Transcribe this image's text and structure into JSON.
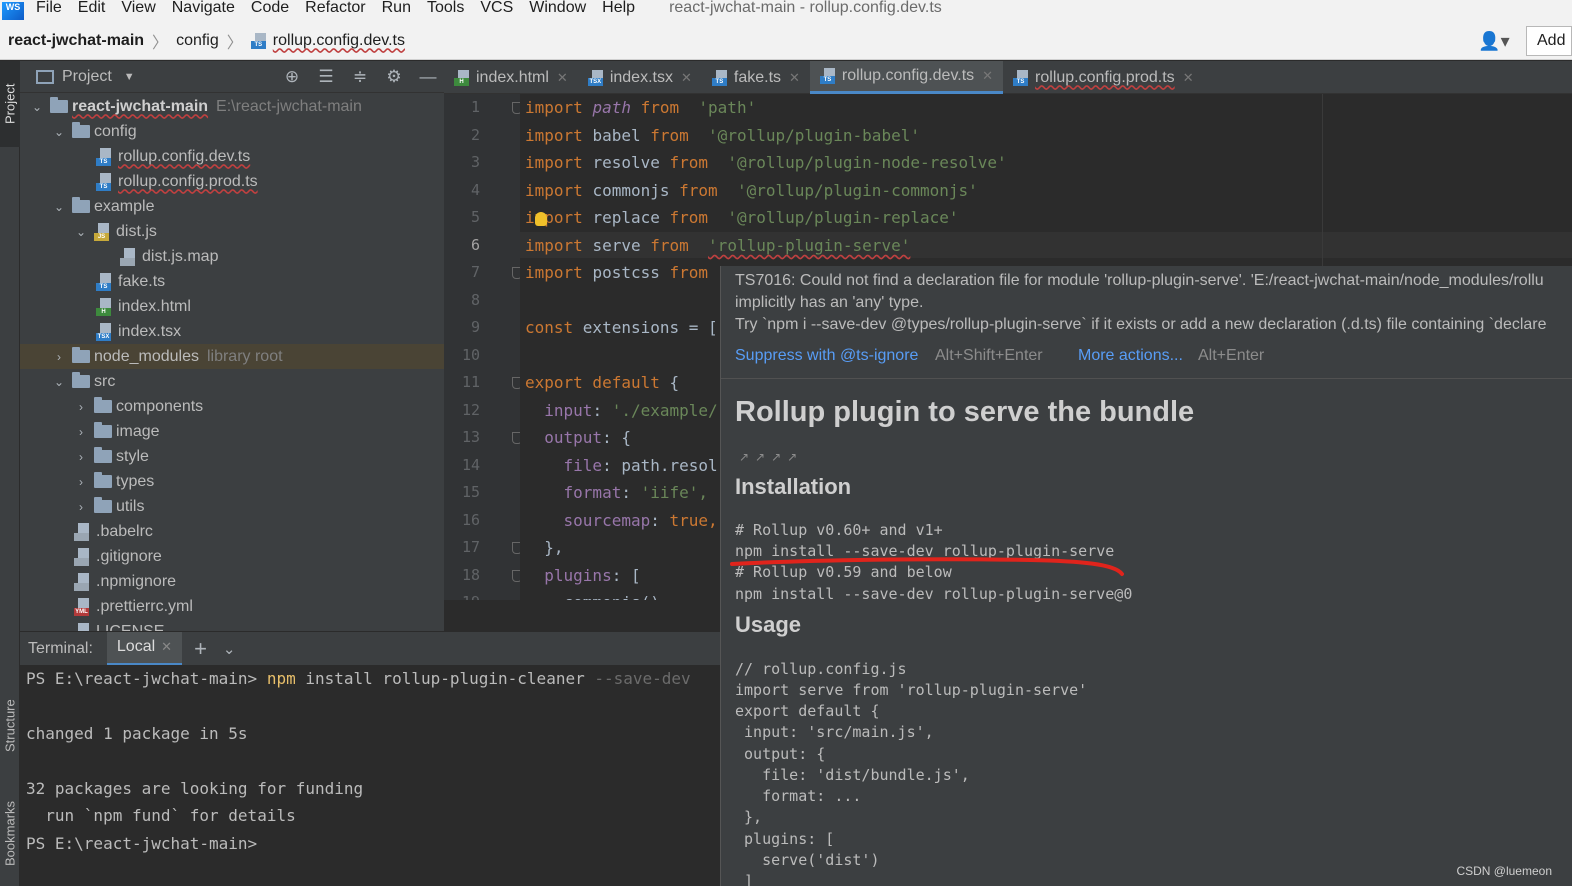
{
  "menubar": {
    "logo": "WS",
    "items": [
      "File",
      "Edit",
      "View",
      "Navigate",
      "Code",
      "Refactor",
      "Run",
      "Tools",
      "VCS",
      "Window",
      "Help"
    ],
    "window_title": "react-jwchat-main - rollup.config.dev.ts"
  },
  "navbar": {
    "project": "react-jwchat-main",
    "folder": "config",
    "file": "rollup.config.dev.ts",
    "add_label": "Add"
  },
  "side_strip": {
    "project": "Project",
    "structure": "Structure",
    "bookmarks": "Bookmarks"
  },
  "project_panel": {
    "title": "Project",
    "root_name": "react-jwchat-main",
    "root_path": "E:\\react-jwchat-main",
    "tree": [
      {
        "label": "config",
        "type": "folder",
        "expanded": true
      },
      {
        "label": "rollup.config.dev.ts",
        "type": "ts"
      },
      {
        "label": "rollup.config.prod.ts",
        "type": "ts"
      },
      {
        "label": "example",
        "type": "folder",
        "expanded": true
      },
      {
        "label": "dist.js",
        "type": "js",
        "expanded": true
      },
      {
        "label": "dist.js.map",
        "type": "map"
      },
      {
        "label": "fake.ts",
        "type": "ts"
      },
      {
        "label": "index.html",
        "type": "html"
      },
      {
        "label": "index.tsx",
        "type": "tsx"
      },
      {
        "label": "node_modules",
        "type": "folder",
        "hint": "library root"
      },
      {
        "label": "src",
        "type": "folder",
        "expanded": true
      },
      {
        "label": "components",
        "type": "folder"
      },
      {
        "label": "image",
        "type": "folder"
      },
      {
        "label": "style",
        "type": "folder"
      },
      {
        "label": "types",
        "type": "folder"
      },
      {
        "label": "utils",
        "type": "folder"
      },
      {
        "label": ".babelrc",
        "type": "gen"
      },
      {
        "label": ".gitignore",
        "type": "gen"
      },
      {
        "label": ".npmignore",
        "type": "gen"
      },
      {
        "label": ".prettierrc.yml",
        "type": "yml"
      },
      {
        "label": "LICENSE",
        "type": "gen"
      }
    ]
  },
  "tabs": [
    {
      "label": "index.html",
      "type": "html"
    },
    {
      "label": "index.tsx",
      "type": "tsx"
    },
    {
      "label": "fake.ts",
      "type": "ts"
    },
    {
      "label": "rollup.config.dev.ts",
      "type": "ts",
      "active": true
    },
    {
      "label": "rollup.config.prod.ts",
      "type": "ts"
    }
  ],
  "editor": {
    "current_line": 6,
    "line_numbers": [
      "1",
      "2",
      "3",
      "4",
      "5",
      "6",
      "7",
      "8",
      "9",
      "10",
      "11",
      "12",
      "13",
      "14",
      "15",
      "16",
      "17",
      "18",
      "19"
    ],
    "lines": [
      {
        "kw": "import ",
        "id": "path",
        "id_style": "it",
        "from": " from ",
        "str": "'path'"
      },
      {
        "kw": "import ",
        "id": "babel",
        "from": " from ",
        "str": "'@rollup/plugin-babel'"
      },
      {
        "kw": "import ",
        "id": "resolve",
        "from": " from ",
        "str": "'@rollup/plugin-node-resolve'"
      },
      {
        "kw": "import ",
        "id": "commonjs",
        "from": " from ",
        "str": "'@rollup/plugin-commonjs'"
      },
      {
        "kw": "import ",
        "id": "replace",
        "from": " from ",
        "str": "'@rollup/plugin-replace'"
      },
      {
        "kw": "import ",
        "id": "serve",
        "from": " from ",
        "str": "'rollup-plugin-serve'"
      },
      {
        "kw": "import ",
        "id": "postcss",
        "from": " from",
        "str": ""
      },
      {
        "kw": "",
        "id": "",
        "from": "",
        "str": ""
      },
      {
        "kw": "const ",
        "id": "extensions = [",
        "from": "",
        "str": ""
      },
      {
        "kw": "",
        "id": "",
        "from": "",
        "str": ""
      },
      {
        "kw": "export default ",
        "id": "{",
        "from": "",
        "str": ""
      },
      {
        "prop": "  input",
        "id": ": ",
        "str": "'./example/"
      },
      {
        "prop": "  output",
        "id": ": {",
        "str": ""
      },
      {
        "prop": "    file",
        "id": ": path.resol",
        "str": ""
      },
      {
        "prop": "    format",
        "id": ": ",
        "str": "'iife',"
      },
      {
        "prop": "    sourcemap",
        "id": ": ",
        "kw2": "true,"
      },
      {
        "prop": "",
        "id": "  },",
        "str": ""
      },
      {
        "prop": "  plugins",
        "id": ": [",
        "str": ""
      },
      {
        "prop": "",
        "id": "    commonjs()",
        "str": ""
      }
    ]
  },
  "terminal": {
    "label": "Terminal:",
    "tab": "Local",
    "lines": [
      {
        "prompt": "PS E:\\react-jwchat-main> ",
        "cmd": "npm",
        "rest": " install rollup-plugin-cleaner ",
        "dim": "--save-dev"
      },
      {
        "text": ""
      },
      {
        "text": "changed 1 package in 5s"
      },
      {
        "text": ""
      },
      {
        "text": "32 packages are looking for funding"
      },
      {
        "text": "  run `npm fund` for details"
      },
      {
        "text": "PS E:\\react-jwchat-main>"
      }
    ]
  },
  "popup": {
    "error_line1": "TS7016: Could not find a declaration file for module 'rollup-plugin-serve'. 'E:/react-jwchat-main/node_modules/rollu",
    "error_line2": "implicitly has an 'any' type.",
    "error_line3": "  Try `npm i --save-dev @types/rollup-plugin-serve` if it exists or add a new declaration (.d.ts) file containing `declare",
    "action1": "Suppress with @ts-ignore",
    "action1_key": "Alt+Shift+Enter",
    "action2": "More actions...",
    "action2_key": "Alt+Enter",
    "doc_title": "Rollup plugin to serve the bundle",
    "installation_heading": "Installation",
    "install_lines": [
      "# Rollup v0.60+ and v1+",
      "npm install --save-dev rollup-plugin-serve",
      "# Rollup v0.59 and below",
      "npm install --save-dev rollup-plugin-serve@0"
    ],
    "usage_heading": "Usage",
    "usage_lines": [
      "// rollup.config.js",
      "import serve from 'rollup-plugin-serve'",
      "export default {",
      " input: 'src/main.js',",
      " output: {",
      "   file: 'dist/bundle.js',",
      "   format: ...",
      " },",
      " plugins: [",
      "   serve('dist')",
      " ]"
    ]
  },
  "watermark": "CSDN @luemeon",
  "colors": {
    "accent": "#4a88c7",
    "keyword": "#cc7832",
    "string": "#6a8759",
    "annotation_red": "#e0241c"
  }
}
